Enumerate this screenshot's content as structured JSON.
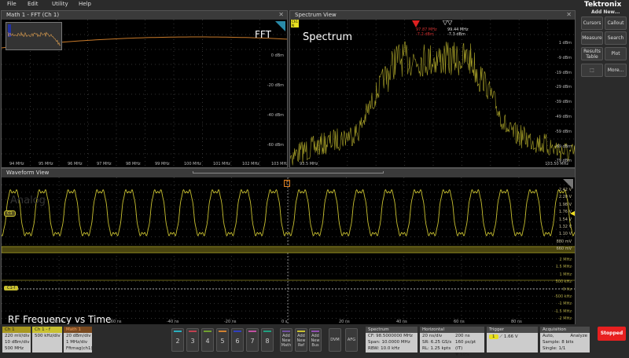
{
  "menu": [
    "File",
    "Edit",
    "Utility",
    "Help"
  ],
  "fft_panel": {
    "title": "Math 1 - FFT (Ch 1)",
    "overlay": "FFT",
    "y_labels": [
      "0 dBm",
      "-20 dBm",
      "-40 dBm",
      "-60 dBm"
    ],
    "x_labels": [
      "94 MHz",
      "95 MHz",
      "96 MHz",
      "97 MHz",
      "98 MHz",
      "99 MHz",
      "100 MHz",
      "101 MHz",
      "102 MHz",
      "103 MHz"
    ],
    "trace_color": "#c87a2a"
  },
  "spectrum_panel": {
    "title": "Spectrum View",
    "overlay": "Spectrum",
    "channel_tag": "Ch1",
    "channel_sub": "N",
    "marker1": {
      "freq": "97.87 MHz",
      "level": "-7.2 dBm"
    },
    "marker2": {
      "freq": "99.44 MHz",
      "level": "-7.3 dBm"
    },
    "y_labels": [
      "1 dBm",
      "-9 dBm",
      "-19 dBm",
      "-29 dBm",
      "-39 dBm",
      "-49 dBm",
      "-59 dBm",
      "-69 dBm",
      "-79 dBm"
    ],
    "x_start": "93.5 MHz",
    "x_end": "103.50 MHz",
    "trace_color": "#c8c030"
  },
  "waveform_panel": {
    "title": "Waveform View",
    "analog_watermark": "Analog",
    "overlay": "RF Frequency vs Time",
    "ch1_tag": "C1",
    "c1f_tag": "C1-f",
    "trigger_tag": "T",
    "volt_labels": [
      "2.42 V",
      "2.20 V",
      "1.98 V",
      "1.76 V",
      "1.54 V",
      "1.32 V",
      "1.10 V",
      "880 mV",
      "660 mV"
    ],
    "freq_labels": [
      "2 MHz",
      "1.5 MHz",
      "1 MHz",
      "500 kHz",
      "0 Hz",
      "-500 kHz",
      "-1 MHz",
      "-1.5 MHz",
      "-2 MHz"
    ],
    "time_labels": [
      "-80 ns",
      "-60 ns",
      "-40 ns",
      "-20 ns",
      "0 s",
      "20 ns",
      "40 ns",
      "60 ns",
      "80 ns"
    ]
  },
  "sidebar": {
    "brand": "Tektronix",
    "add_new": "Add New...",
    "buttons": [
      "Cursors",
      "Callout",
      "Measure",
      "Search",
      "Results Table",
      "Plot"
    ],
    "more": "More..."
  },
  "bottom": {
    "ch1": {
      "title": "Ch 1",
      "lines": [
        "220 mV/div",
        "10 dBm/div",
        "500 MHz"
      ]
    },
    "ch1f": {
      "title": "Ch 1 - f",
      "lines": [
        "500 kHz/div"
      ]
    },
    "math1": {
      "title": "Math 1",
      "lines": [
        "20 dBm/div",
        "1 MHz/div",
        "Fftmag(ch1)"
      ]
    },
    "channels": [
      {
        "label": "2",
        "color": "#2ab0c0"
      },
      {
        "label": "3",
        "color": "#c04050"
      },
      {
        "label": "4",
        "color": "#70a030"
      },
      {
        "label": "5",
        "color": "#d08030"
      },
      {
        "label": "6",
        "color": "#3040c0"
      },
      {
        "label": "7",
        "color": "#c050a0"
      },
      {
        "label": "8",
        "color": "#20a080"
      }
    ],
    "add_math": "Add New Math",
    "add_ref": "Add New Ref",
    "add_bus": "Add New Bus",
    "dvm": "DVM",
    "afg": "AFG",
    "spectrum": {
      "title": "Spectrum",
      "lines": [
        "CF: 98.5000000 MHz",
        "Span: 10.0000 MHz",
        "RBW: 10.0 kHz"
      ]
    },
    "horizontal": {
      "title": "Horizontal",
      "left": [
        "20 ns/div",
        "SR: 6.25 GS/s",
        "RL: 1.25 kpts"
      ],
      "right": [
        "200 ns",
        "160 ps/pt (IT)",
        "50%"
      ]
    },
    "trigger": {
      "title": "Trigger",
      "source": "1",
      "level": "1.66 V"
    },
    "acquisition": {
      "title": "Acquisition",
      "mode": "Auto,",
      "analyze": "Analyze",
      "lines": [
        "Sample: 8 bits",
        "Single: 1/1"
      ]
    },
    "stopped": "Stopped"
  }
}
